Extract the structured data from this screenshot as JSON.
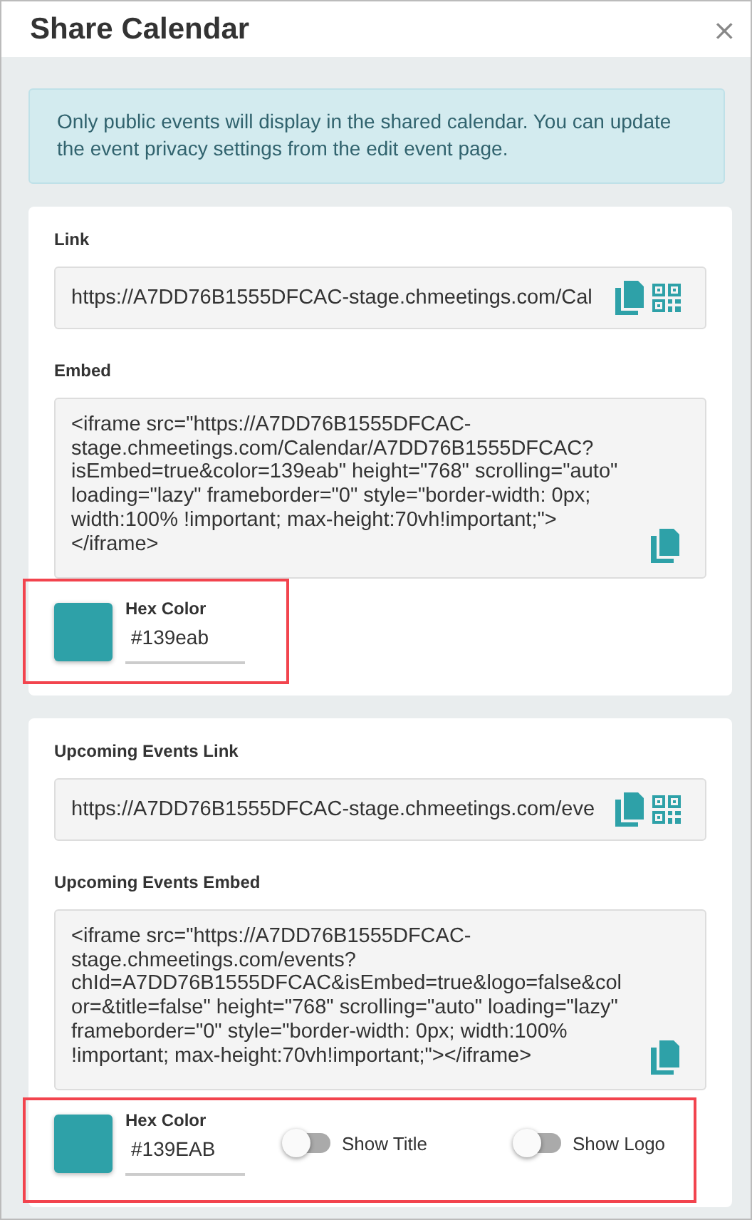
{
  "dialog": {
    "title": "Share Calendar",
    "close": "×"
  },
  "notice": "Only public events will display in the shared calendar. You can update the event privacy settings from the edit event page.",
  "cards": [
    {
      "sections": [
        {
          "kind": "link",
          "label": "Link",
          "value": "https://A7DD76B1555DFCAC-stage.chmeetings.com/Cal"
        },
        {
          "kind": "embed",
          "label": "Embed",
          "value": "<iframe src=\"https://A7DD76B1555DFCAC-stage.chmeetings.com/Calendar/A7DD76B1555DFCAC?isEmbed=true&color=139eab\" height=\"768\" scrolling=\"auto\" loading=\"lazy\" frameborder=\"0\" style=\"border-width: 0px; width:100% !important; max-height:70vh!important;\"></iframe>"
        }
      ],
      "color_row": {
        "highlighted": true,
        "label": "Hex Color",
        "value": "#139eab",
        "color": "#2ea1a8"
      }
    },
    {
      "sections": [
        {
          "kind": "link",
          "label": "Upcoming Events Link",
          "value": "https://A7DD76B1555DFCAC-stage.chmeetings.com/eve"
        },
        {
          "kind": "embed",
          "label": "Upcoming Events Embed",
          "value": "<iframe src=\"https://A7DD76B1555DFCAC-stage.chmeetings.com/events?chId=A7DD76B1555DFCAC&isEmbed=true&logo=false&color=&title=false\" height=\"768\" scrolling=\"auto\" loading=\"lazy\" frameborder=\"0\" style=\"border-width: 0px; width:100% !important; max-height:70vh!important;\"></iframe>"
        }
      ],
      "color_row": {
        "highlighted": true,
        "label": "Hex Color",
        "value": "#139EAB",
        "color": "#2ea1a8",
        "toggles": [
          {
            "label": "Show Title",
            "on": false
          },
          {
            "label": "Show Logo",
            "on": false
          }
        ]
      }
    }
  ]
}
